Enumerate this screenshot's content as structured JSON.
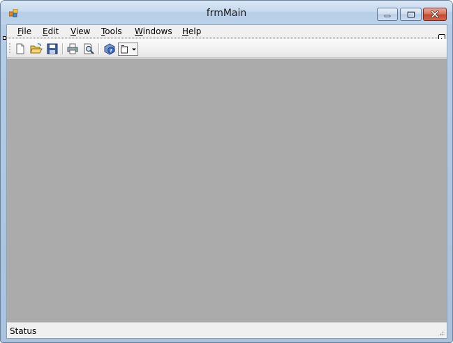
{
  "window": {
    "title": "frmMain",
    "app_icon": "windows-forms-icon",
    "caption_buttons": [
      "minimize-icon",
      "maximize-icon",
      "close-icon"
    ]
  },
  "menu": {
    "items": [
      {
        "label": "File",
        "accesskey": "F"
      },
      {
        "label": "Edit",
        "accesskey": "E"
      },
      {
        "label": "View",
        "accesskey": "V"
      },
      {
        "label": "Tools",
        "accesskey": "T"
      },
      {
        "label": "Windows",
        "accesskey": "W"
      },
      {
        "label": "Help",
        "accesskey": "H"
      }
    ]
  },
  "toolbar": {
    "buttons": [
      {
        "name": "new-document",
        "icon": "new-document-icon"
      },
      {
        "name": "open-folder",
        "icon": "open-folder-icon"
      },
      {
        "name": "save",
        "icon": "save-disk-icon"
      },
      {
        "name": "print",
        "icon": "printer-icon"
      },
      {
        "name": "print-preview",
        "icon": "print-preview-icon"
      },
      {
        "name": "help",
        "icon": "help-icon"
      },
      {
        "name": "window-split",
        "icon": "window-dropdown-icon"
      }
    ]
  },
  "mdi": {
    "background": "#ababab"
  },
  "status": {
    "label": "Status"
  },
  "colors": {
    "titlebar": "#c6d9ee",
    "close": "#c44a2d",
    "client": "#f0f0f0"
  }
}
